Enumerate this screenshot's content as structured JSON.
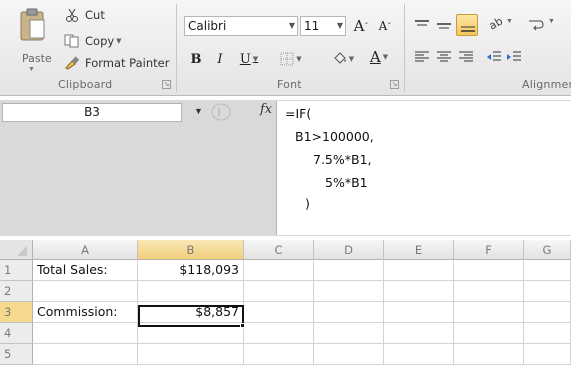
{
  "ribbon": {
    "clipboard": {
      "paste_label": "Paste",
      "cut_label": "Cut",
      "copy_label": "Copy",
      "format_painter_label": "Format Painter",
      "group_label": "Clipboard"
    },
    "font": {
      "font_name": "Calibri",
      "font_size": "11",
      "bold_label": "B",
      "italic_label": "I",
      "underline_label": "U",
      "grow_label": "A",
      "shrink_label": "A",
      "font_color_label": "A",
      "group_label": "Font"
    },
    "alignment": {
      "group_label": "Alignmen"
    }
  },
  "formula_bar": {
    "name_box": "B3",
    "fx_label": "fx",
    "formula_lines": [
      "=IF(",
      "B1>100000,",
      "7.5%*B1,",
      "5%*B1",
      ")"
    ]
  },
  "grid": {
    "columns": [
      "A",
      "B",
      "C",
      "D",
      "E",
      "F",
      "G"
    ],
    "rows": [
      "1",
      "2",
      "3",
      "4",
      "5"
    ],
    "cells": {
      "A1": "Total Sales:",
      "B1": "$118,093",
      "A3": "Commission:",
      "B3": "$8,857"
    },
    "active_cell": "B3"
  }
}
